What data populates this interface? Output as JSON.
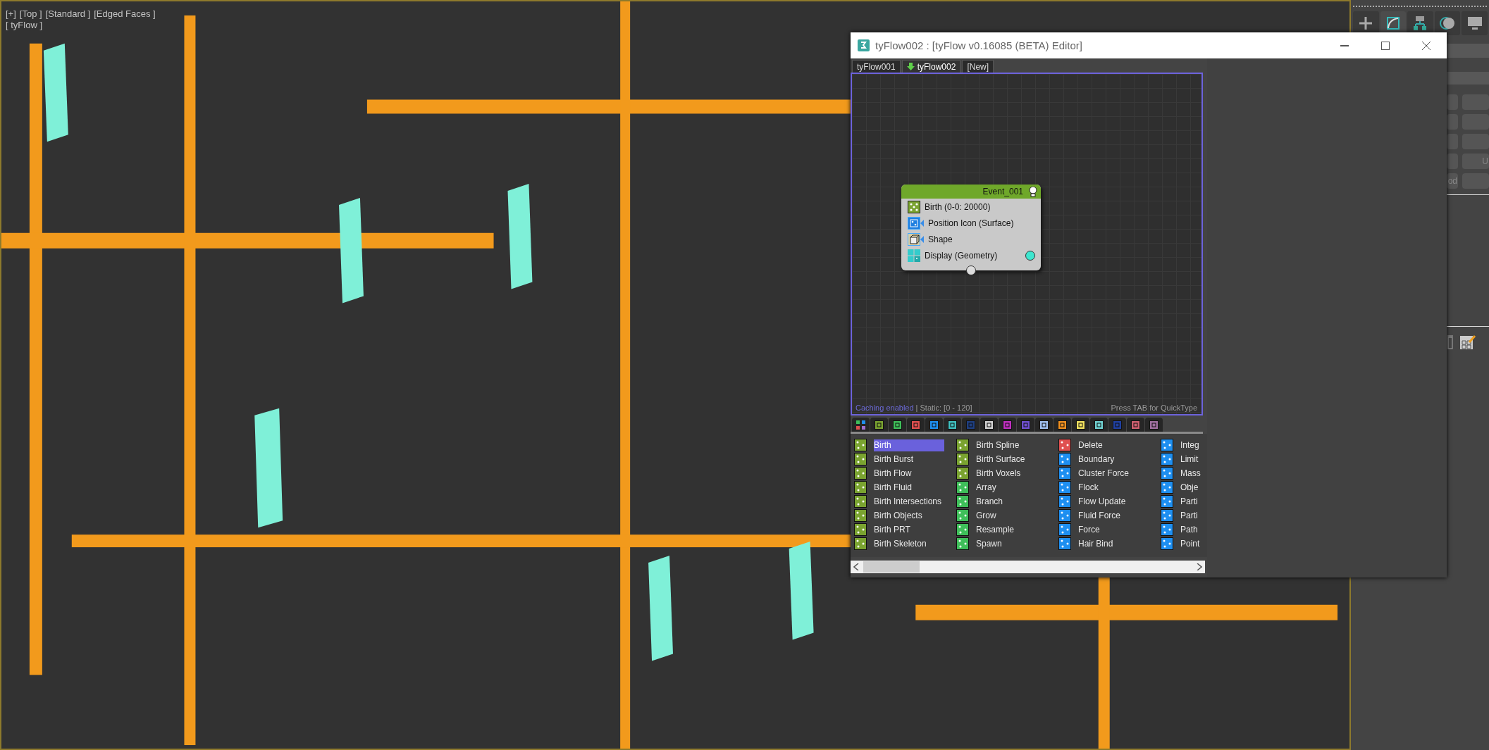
{
  "viewport": {
    "kind": "picture",
    "labels": [
      "[+]",
      "[Top ]",
      "[Standard ]",
      "[Edged Faces ]"
    ],
    "object_label": "[ tyFlow ]"
  },
  "command_panel": {
    "tools": [
      {
        "kind": "create",
        "selected": false
      },
      {
        "kind": "modify",
        "selected": true
      },
      {
        "kind": "hierarchy",
        "selected": false
      },
      {
        "kind": "motion",
        "selected": false
      },
      {
        "kind": "display",
        "selected": false
      }
    ],
    "button_rows": [
      {
        "kind": "blank"
      },
      {
        "kind": "blank"
      },
      {
        "kind": "blank"
      },
      {
        "kind": "labeled",
        "right": "U"
      },
      {
        "kind": "labeled",
        "left": "od"
      }
    ]
  },
  "editor": {
    "title": "tyFlow002 : [tyFlow v0.16085 (BETA) Editor]",
    "tabs": [
      {
        "label": "tyFlow001",
        "selected": false
      },
      {
        "label": "tyFlow002",
        "selected": true
      },
      {
        "label": "[New]",
        "selected": false
      }
    ],
    "graph": {
      "node": {
        "title": "Event_001",
        "operators": [
          {
            "label": "Birth (0-0: 20000)",
            "kind": "birth",
            "linked": false,
            "output": false
          },
          {
            "label": "Position Icon (Surface)",
            "kind": "position",
            "linked": true,
            "output": false
          },
          {
            "label": "Shape",
            "kind": "shape",
            "linked": true,
            "output": false
          },
          {
            "label": "Display (Geometry)",
            "kind": "display",
            "linked": false,
            "output": true
          }
        ]
      },
      "status": {
        "caching": "Caching enabled",
        "range": "| Static: [0 - 120]",
        "hint": "Press TAB for QuickType"
      }
    },
    "category_tabs": [
      {
        "kind": "all"
      },
      {
        "kind": "color",
        "color": "#7aa330"
      },
      {
        "kind": "color",
        "color": "#3fbf5a"
      },
      {
        "kind": "color",
        "color": "#e05050"
      },
      {
        "kind": "color",
        "color": "#1e8ff0"
      },
      {
        "kind": "color",
        "color": "#40c0c0"
      },
      {
        "kind": "color",
        "color": "#1f3f80"
      },
      {
        "kind": "color",
        "color": "#d0d0d0"
      },
      {
        "kind": "color",
        "color": "#c030c0"
      },
      {
        "kind": "color",
        "color": "#7050d0"
      },
      {
        "kind": "color",
        "color": "#a0c0f0"
      },
      {
        "kind": "color",
        "color": "#f09020"
      },
      {
        "kind": "color",
        "color": "#f0e060"
      },
      {
        "kind": "color",
        "color": "#70d0d0"
      },
      {
        "kind": "color",
        "color": "#2040a0"
      },
      {
        "kind": "color",
        "color": "#d06070"
      },
      {
        "kind": "color",
        "color": "#a070a0"
      }
    ],
    "operator_columns": [
      {
        "items": [
          {
            "label": "Birth",
            "color": "#7aa330",
            "selected": true
          },
          {
            "label": "Birth Burst",
            "color": "#7aa330",
            "selected": false
          },
          {
            "label": "Birth Flow",
            "color": "#7aa330",
            "selected": false
          },
          {
            "label": "Birth Fluid",
            "color": "#7aa330",
            "selected": false
          },
          {
            "label": "Birth Intersections",
            "color": "#7aa330",
            "selected": false
          },
          {
            "label": "Birth Objects",
            "color": "#7aa330",
            "selected": false
          },
          {
            "label": "Birth PRT",
            "color": "#7aa330",
            "selected": false
          },
          {
            "label": "Birth Skeleton",
            "color": "#7aa330",
            "selected": false
          }
        ]
      },
      {
        "items": [
          {
            "label": "Birth Spline",
            "color": "#7aa330",
            "selected": false
          },
          {
            "label": "Birth Surface",
            "color": "#7aa330",
            "selected": false
          },
          {
            "label": "Birth Voxels",
            "color": "#7aa330",
            "selected": false
          },
          {
            "label": "Array",
            "color": "#3fbf5a",
            "selected": false
          },
          {
            "label": "Branch",
            "color": "#3fbf5a",
            "selected": false
          },
          {
            "label": "Grow",
            "color": "#3fbf5a",
            "selected": false
          },
          {
            "label": "Resample",
            "color": "#3fbf5a",
            "selected": false
          },
          {
            "label": "Spawn",
            "color": "#3fbf5a",
            "selected": false
          }
        ]
      },
      {
        "items": [
          {
            "label": "Delete",
            "color": "#e05050",
            "selected": false
          },
          {
            "label": "Boundary",
            "color": "#1e8ff0",
            "selected": false
          },
          {
            "label": "Cluster Force",
            "color": "#1e8ff0",
            "selected": false
          },
          {
            "label": "Flock",
            "color": "#1e8ff0",
            "selected": false
          },
          {
            "label": "Flow Update",
            "color": "#1e8ff0",
            "selected": false
          },
          {
            "label": "Fluid Force",
            "color": "#1e8ff0",
            "selected": false
          },
          {
            "label": "Force",
            "color": "#1e8ff0",
            "selected": false
          },
          {
            "label": "Hair Bind",
            "color": "#1e8ff0",
            "selected": false
          }
        ]
      },
      {
        "items": [
          {
            "label": "Integ",
            "color": "#1e8ff0",
            "selected": false
          },
          {
            "label": "Limit",
            "color": "#1e8ff0",
            "selected": false
          },
          {
            "label": "Mass",
            "color": "#1e8ff0",
            "selected": false
          },
          {
            "label": "Obje",
            "color": "#1e8ff0",
            "selected": false
          },
          {
            "label": "Parti",
            "color": "#1e8ff0",
            "selected": false
          },
          {
            "label": "Parti",
            "color": "#1e8ff0",
            "selected": false
          },
          {
            "label": "Path",
            "color": "#1e8ff0",
            "selected": false
          },
          {
            "label": "Point",
            "color": "#1e8ff0",
            "selected": false
          }
        ]
      }
    ]
  }
}
